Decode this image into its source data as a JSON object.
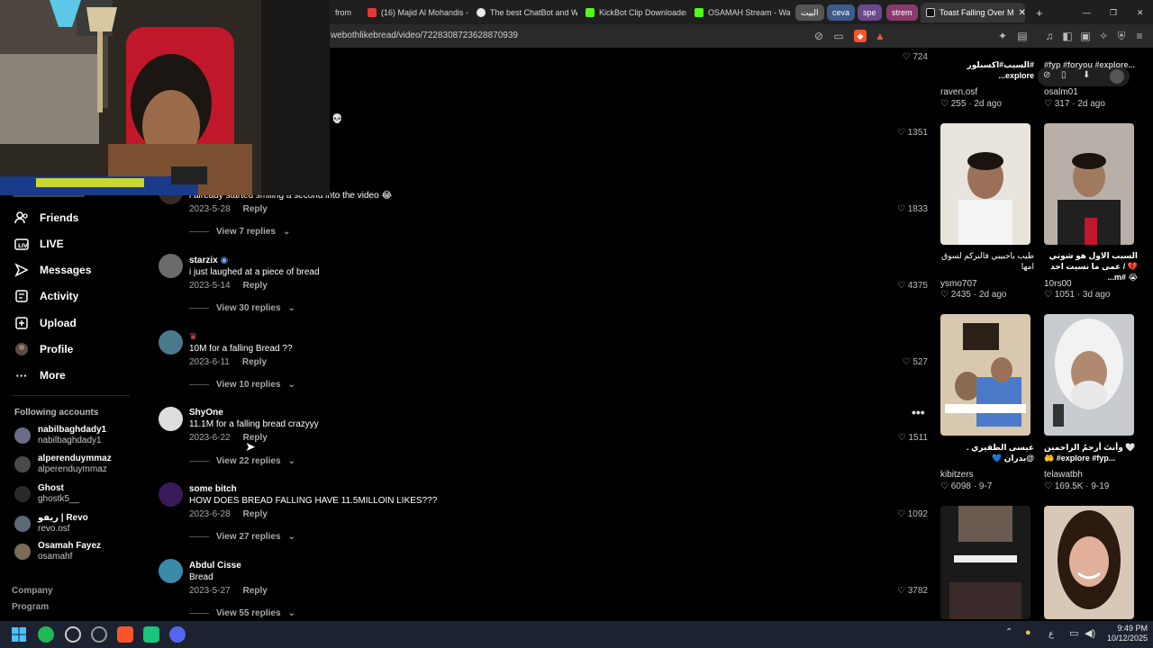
{
  "tabs": [
    {
      "label": "from"
    },
    {
      "label": "(16) Majid Al Mohandis -"
    },
    {
      "label": "The best ChatBot and W"
    },
    {
      "label": "KickBot Clip Downloader"
    },
    {
      "label": "OSAMAH Stream - Watc"
    }
  ],
  "tab_groups": [
    "البيت",
    "ceva",
    "spe",
    "strem"
  ],
  "active_tab": "Toast Falling Over M",
  "url": "webothlikebread/video/7228308723628870939",
  "sidebar": {
    "items": [
      {
        "label": "Friends",
        "icon": "friends-icon"
      },
      {
        "label": "LIVE",
        "icon": "live-icon"
      },
      {
        "label": "Messages",
        "icon": "messages-icon"
      },
      {
        "label": "Activity",
        "icon": "activity-icon"
      },
      {
        "label": "Upload",
        "icon": "upload-icon"
      },
      {
        "label": "Profile",
        "icon": "profile-icon"
      },
      {
        "label": "More",
        "icon": "more-icon"
      }
    ],
    "following_title": "Following accounts",
    "accounts": [
      {
        "name": "nabilbaghdady1",
        "handle": "nabilbaghdady1"
      },
      {
        "name": "alperenduymmaz",
        "handle": "alperenduymmaz"
      },
      {
        "name": "Ghost",
        "handle": "ghostk5__"
      },
      {
        "name": "ريفو | Revo",
        "handle": "revo.osf"
      },
      {
        "name": "Osamah Fayez",
        "handle": "osamahf"
      }
    ],
    "footer": [
      "Company",
      "Program"
    ]
  },
  "comments": {
    "top_likes": [
      "724",
      "1351"
    ],
    "first": {
      "text": "i already started smiling a second into the video 😂",
      "date": "2023-5-28",
      "reply": "Reply",
      "likes": "1833",
      "views": "View 7 replies"
    },
    "list": [
      {
        "name": "starzix",
        "text": "i just laughed at a piece of bread",
        "date": "2023-5-14",
        "reply": "Reply",
        "likes": "4375",
        "views": "View 30 replies"
      },
      {
        "name": "",
        "text": "10M for a falling Bread ??",
        "date": "2023-6-11",
        "reply": "Reply",
        "likes": "527",
        "views": "View 10 replies"
      },
      {
        "name": "ShyOne",
        "text": "11.1M for a falling bread crazyyy",
        "date": "2023-6-22",
        "reply": "Reply",
        "likes": "1511",
        "views": "View 22 replies"
      },
      {
        "name": "some bitch",
        "text": "HOW DOES BREAD FALLING HAVE 11.5MILLOIN LIKES???",
        "date": "2023-6-28",
        "reply": "Reply",
        "likes": "1092",
        "views": "View 27 replies"
      },
      {
        "name": "Abdul Cisse",
        "text": "Bread",
        "date": "2023-5-27",
        "reply": "Reply",
        "likes": "3782",
        "views": "View 55 replies"
      }
    ]
  },
  "videos": [
    {
      "caption": "#السيب#اكسبلور explore...",
      "user": "raven.osf",
      "likes": "255",
      "age": "2d ago"
    },
    {
      "caption": "#fyp #foryou #explore...",
      "user": "osalm01",
      "likes": "317",
      "age": "2d ago"
    },
    {
      "caption": "طيب ياحبيبي فالنركم لسوق امها",
      "user": "ysmo707",
      "likes": "2435",
      "age": "2d ago"
    },
    {
      "caption": "السبب الاول هو شوتي 💔 / عمى ما نسيت احد 😭 #m...",
      "user": "10rs00",
      "likes": "1051",
      "age": "3d ago"
    },
    {
      "caption": "عيسى الظفيري . @بدران 💙",
      "user": "kibitzers",
      "likes": "6098",
      "age": "9-7"
    },
    {
      "caption": "وأنتَ أرحمُ الراحمين 🤍🤲 #explore #fyp...",
      "user": "telawatbh",
      "likes": "169.5K",
      "age": "9-19"
    }
  ],
  "taskbar": {
    "time": "9:49 PM",
    "date": "10/12/2025",
    "lang": "ع"
  }
}
